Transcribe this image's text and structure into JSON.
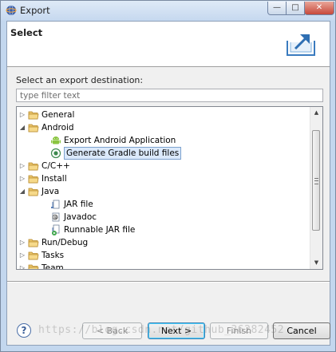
{
  "window": {
    "title": "Export",
    "buttons": {
      "minimize": "—",
      "maximize": "□",
      "close": "✕"
    }
  },
  "header": {
    "title": "Select",
    "icon": "export-wizard-icon"
  },
  "destination_label": "Select an export destination:",
  "filter": {
    "placeholder": "type filter text",
    "value": ""
  },
  "tree": [
    {
      "label": "General",
      "icon": "folder-icon",
      "expanded": false,
      "level": 0
    },
    {
      "label": "Android",
      "icon": "folder-icon",
      "expanded": true,
      "level": 0
    },
    {
      "label": "Export Android Application",
      "icon": "android-icon",
      "level": 1
    },
    {
      "label": "Generate Gradle build files",
      "icon": "gradle-icon",
      "level": 1,
      "selected": true
    },
    {
      "label": "C/C++",
      "icon": "folder-icon",
      "expanded": false,
      "level": 0
    },
    {
      "label": "Install",
      "icon": "folder-icon",
      "expanded": false,
      "level": 0
    },
    {
      "label": "Java",
      "icon": "folder-icon",
      "expanded": true,
      "level": 0
    },
    {
      "label": "JAR file",
      "icon": "jar-icon",
      "level": 1
    },
    {
      "label": "Javadoc",
      "icon": "javadoc-icon",
      "level": 1
    },
    {
      "label": "Runnable JAR file",
      "icon": "runnable-jar-icon",
      "level": 1
    },
    {
      "label": "Run/Debug",
      "icon": "folder-icon",
      "expanded": false,
      "level": 0
    },
    {
      "label": "Tasks",
      "icon": "folder-icon",
      "expanded": false,
      "level": 0
    },
    {
      "label": "Team",
      "icon": "folder-icon",
      "expanded": false,
      "level": 0
    }
  ],
  "buttons": {
    "help": "?",
    "back": "< Back",
    "next": "Next >",
    "finish": "Finish",
    "cancel": "Cancel"
  },
  "watermark": "https://blog.csdn.net/github_36282452"
}
